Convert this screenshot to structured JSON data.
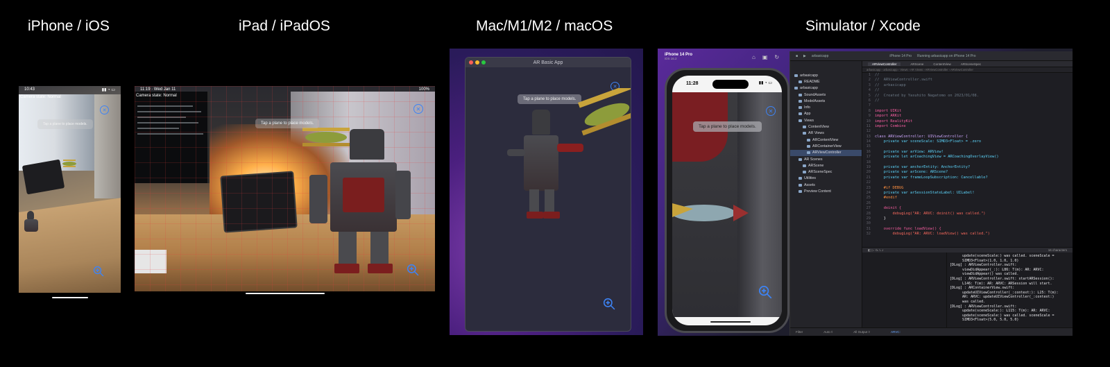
{
  "headings": {
    "iphone": "iPhone / iOS",
    "ipad": "iPad / iPadOS",
    "mac": "Mac/M1/M2 / macOS",
    "simulator": "Simulator / Xcode"
  },
  "iphone": {
    "time": "10:43",
    "camera_state": "Camera state: Normal",
    "hint": "Tap a plane to place models."
  },
  "ipad": {
    "time": "11:19 · Wed Jan 11",
    "battery": "100%",
    "camera_state": "Camera state: Normal",
    "hint": "Tap a plane to place models."
  },
  "mac": {
    "window_title": "AR Basic App",
    "hint": "Tap a plane to place models."
  },
  "simulator": {
    "device_name": "iPhone 14 Pro",
    "os_version": "iOS 16.2",
    "time": "11:28",
    "hint": "Tap a plane to place models."
  },
  "xcode": {
    "project": "arbasicapp",
    "scheme": "iPhone 14 Pro",
    "status": "Running arbasicapp on iPhone 14 Pro",
    "tabs": [
      "ARViewController",
      "ARScene",
      "ContentView",
      "ARSceneSpec"
    ],
    "jumpbar": "arbasicapp › arbasicapp › Views › AR Views › ARViewController › ARViewController",
    "navigator": [
      {
        "label": "arbasicapp",
        "indent": 0
      },
      {
        "label": "README",
        "indent": 1
      },
      {
        "label": "arbasicapp",
        "indent": 0
      },
      {
        "label": "SoundAssets",
        "indent": 1
      },
      {
        "label": "ModelAssets",
        "indent": 1
      },
      {
        "label": "Info",
        "indent": 1
      },
      {
        "label": "App",
        "indent": 1
      },
      {
        "label": "Views",
        "indent": 1
      },
      {
        "label": "ContentView",
        "indent": 2
      },
      {
        "label": "AR Views",
        "indent": 2
      },
      {
        "label": "ARContentView",
        "indent": 3
      },
      {
        "label": "ARContainerView",
        "indent": 3
      },
      {
        "label": "ARViewController",
        "indent": 3,
        "selected": true
      },
      {
        "label": "AR Scenes",
        "indent": 1
      },
      {
        "label": "ARScene",
        "indent": 2
      },
      {
        "label": "ARSceneSpec",
        "indent": 2
      },
      {
        "label": "Utilities",
        "indent": 1
      },
      {
        "label": "Assets",
        "indent": 1
      },
      {
        "label": "Preview Content",
        "indent": 1
      }
    ],
    "code": [
      {
        "n": "1",
        "t": "//",
        "c": "cm"
      },
      {
        "n": "2",
        "t": "//  ARViewController.swift",
        "c": "cm"
      },
      {
        "n": "3",
        "t": "//  arbasicapp",
        "c": "cm"
      },
      {
        "n": "4",
        "t": "//",
        "c": "cm"
      },
      {
        "n": "5",
        "t": "//  Created by Yasuhito Nagatomo on 2023/01/08.",
        "c": "cm"
      },
      {
        "n": "6",
        "t": "//",
        "c": "cm"
      },
      {
        "n": "7",
        "t": "",
        "c": ""
      },
      {
        "n": "8",
        "t": "import UIKit",
        "c": "kw"
      },
      {
        "n": "9",
        "t": "import ARKit",
        "c": "kw"
      },
      {
        "n": "10",
        "t": "import RealityKit",
        "c": "kw"
      },
      {
        "n": "11",
        "t": "import Combine",
        "c": "kw"
      },
      {
        "n": "12",
        "t": "",
        "c": ""
      },
      {
        "n": "13",
        "t": "class ARViewController: UIViewController {",
        "c": "ty"
      },
      {
        "n": "14",
        "t": "    private var sceneScale: SIMD3<Float> = .zero",
        "c": "pr"
      },
      {
        "n": "15",
        "t": "",
        "c": ""
      },
      {
        "n": "16",
        "t": "    private var arView: ARView!",
        "c": "pr"
      },
      {
        "n": "17",
        "t": "    private let arCoachingView = ARCoachingOverlayView()",
        "c": "pr"
      },
      {
        "n": "18",
        "t": "",
        "c": ""
      },
      {
        "n": "19",
        "t": "    private var anchorEntity: AnchorEntity?",
        "c": "pr"
      },
      {
        "n": "20",
        "t": "    private var arScene: ARScene?",
        "c": "pr"
      },
      {
        "n": "21",
        "t": "    private var frameLoopSubscription: Cancellable?",
        "c": "pr"
      },
      {
        "n": "22",
        "t": "",
        "c": ""
      },
      {
        "n": "23",
        "t": "    #if DEBUG",
        "c": "pp"
      },
      {
        "n": "24",
        "t": "    private var arSessionStateLabel: UILabel!",
        "c": "pr"
      },
      {
        "n": "25",
        "t": "    #endif",
        "c": "pp"
      },
      {
        "n": "26",
        "t": "",
        "c": ""
      },
      {
        "n": "27",
        "t": "    deinit {",
        "c": "kw"
      },
      {
        "n": "28",
        "t": "        debugLog(\"AR: ARVC: deinit() was called.\")",
        "c": "st"
      },
      {
        "n": "29",
        "t": "    }",
        "c": ""
      },
      {
        "n": "30",
        "t": "",
        "c": ""
      },
      {
        "n": "31",
        "t": "    override func loadView() {",
        "c": "kw"
      },
      {
        "n": "32",
        "t": "        debugLog(\"AR: ARVC: loadView() was called.\")",
        "c": "st"
      }
    ],
    "debug_right": "16 characters",
    "console": "      update(sceneScale:) was called. sceneScale =\n      SIMD3<Float>(1.0, 1.0, 1.0)\n[DLog] : ARViewController.swift:\n      viewDidAppear(_:): L86: T(m): AR: ARVC:\n      viewDidAppear() was called.\n[DLog] : ARViewController.swift: startARSession():\n      L146: T(m): AR: ARVC: ARSession will start.\n[DLog] : ARContainerView.swift:\n      updateUIViewController(_:context:): L25: T(m):\n      AR: ARVC: updateUIViewController(_:context:)\n      was called.\n[DLog] : ARViewController.swift:\n      update(sceneScale:): L115: T(m): AR: ARVC:\n      update(sceneScale:) was called. sceneScale =\n      SIMD3<Float>(5.0, 5.0, 5.0)",
    "status_left": "Filter",
    "status_auto": "Auto ◊",
    "status_output": "All Output ◊",
    "status_filter": "ARVC:"
  }
}
